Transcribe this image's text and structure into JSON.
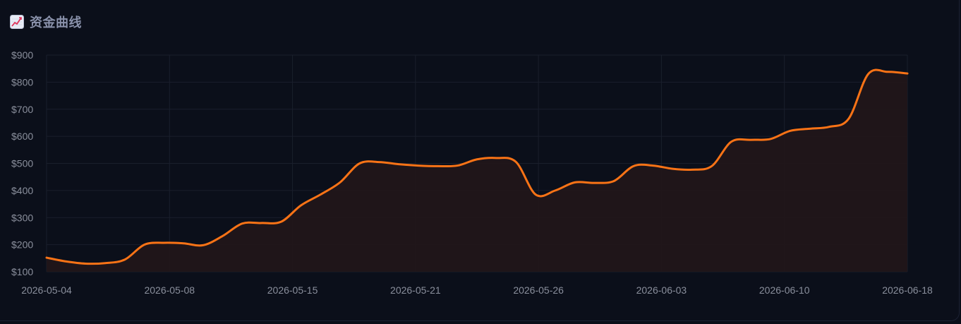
{
  "header": {
    "title": "资金曲线",
    "icon": "chart-increasing-icon"
  },
  "colors": {
    "line": "#f97316",
    "area": "#211619",
    "grid": "#1a1f2c",
    "background": "#0b0f1a"
  },
  "chart_data": {
    "type": "area",
    "title": "资金曲线",
    "xlabel": "",
    "ylabel": "",
    "ylim": [
      100,
      900
    ],
    "grid": true,
    "y_ticks": [
      "$100",
      "$200",
      "$300",
      "$400",
      "$500",
      "$600",
      "$700",
      "$800",
      "$900"
    ],
    "x_ticks": [
      "2026-05-04",
      "2026-05-08",
      "2026-05-15",
      "2026-05-21",
      "2026-05-26",
      "2026-06-03",
      "2026-06-10",
      "2026-06-18"
    ],
    "series": [
      {
        "values": [
          152,
          138,
          130,
          132,
          145,
          200,
          207,
          205,
          198,
          232,
          278,
          280,
          285,
          345,
          385,
          430,
          500,
          505,
          497,
          492,
          490,
          492,
          515,
          520,
          505,
          385,
          400,
          430,
          428,
          435,
          490,
          492,
          480,
          477,
          490,
          580,
          587,
          590,
          620,
          628,
          635,
          665,
          830,
          838,
          832
        ]
      }
    ]
  }
}
